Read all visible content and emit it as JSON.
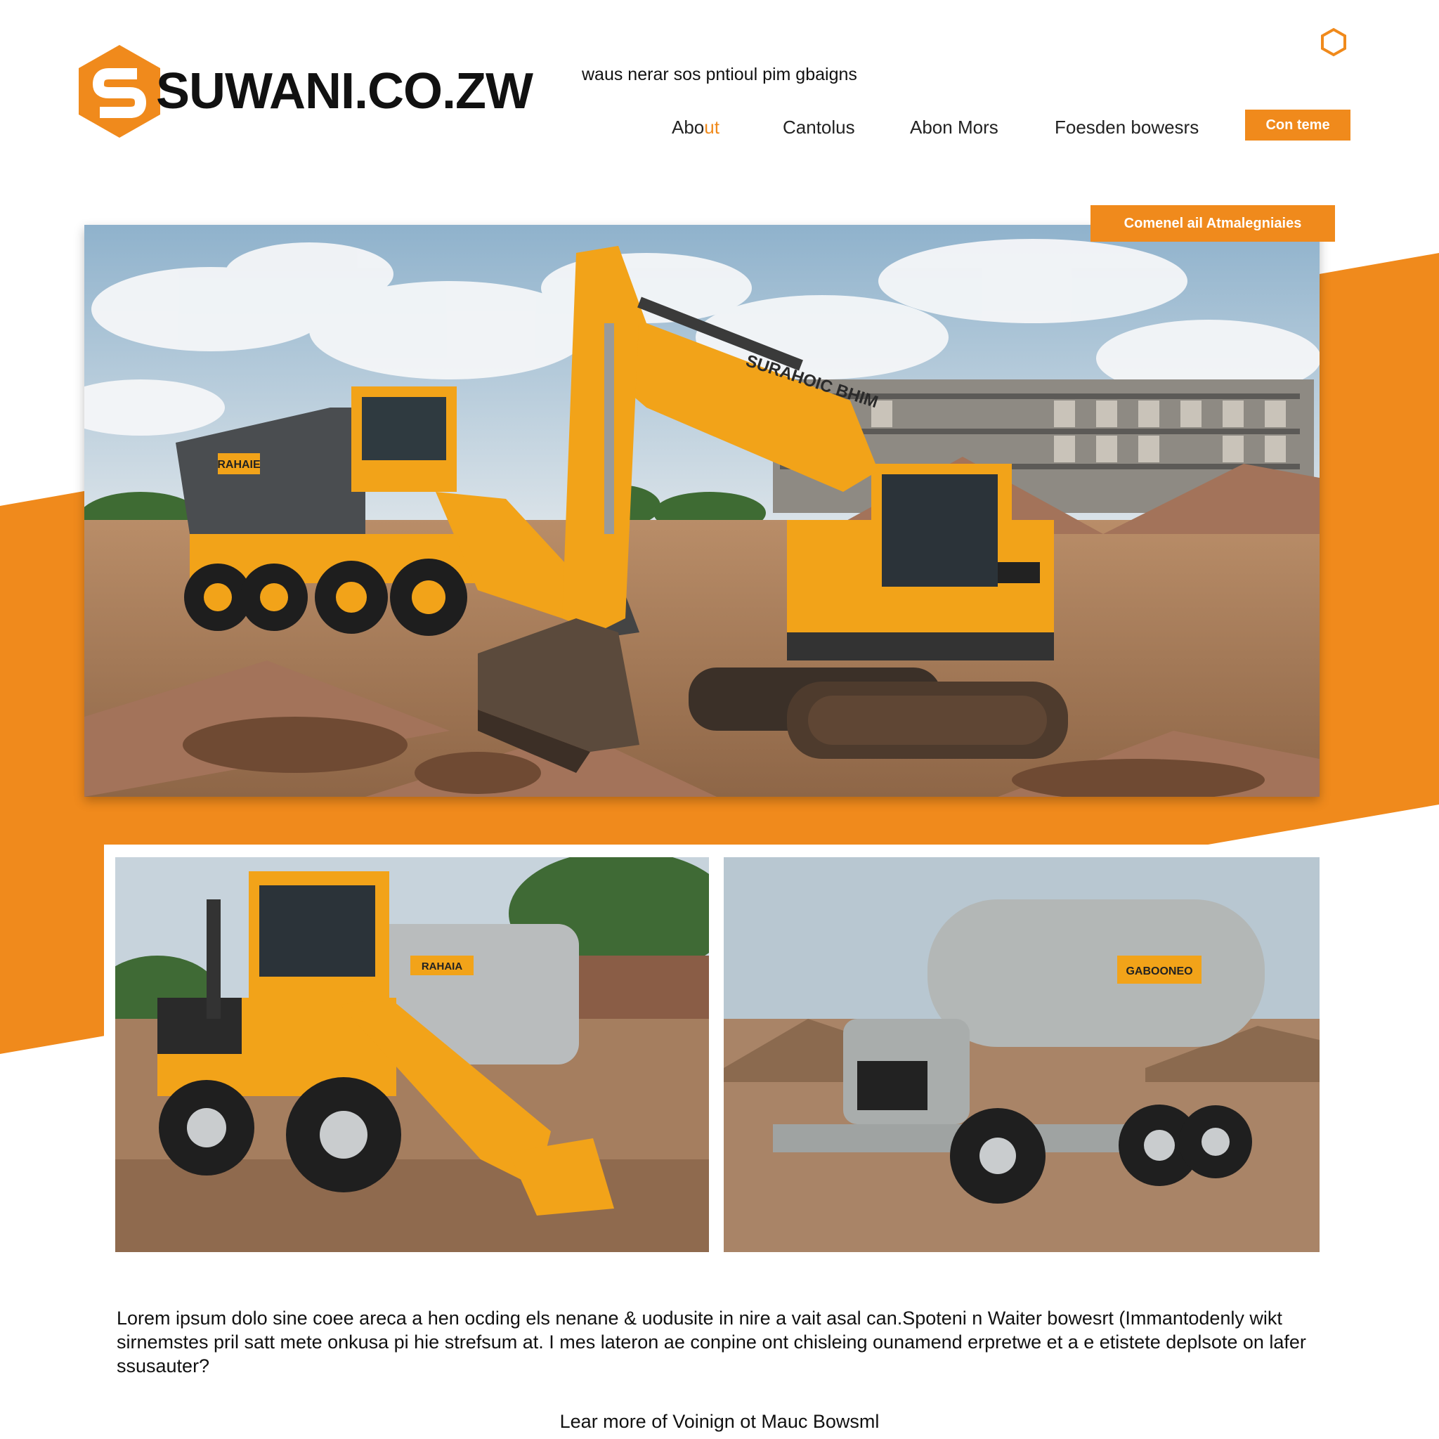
{
  "header": {
    "logo_text": "SUWANI.CO.ZW",
    "tagline": "waus nerar sos pntioul pim gbaigns",
    "nav": {
      "about_main": "Abo",
      "about_accent": "ut",
      "item2": "Cantolus",
      "item3": "Abon Mors",
      "item4": "Foesden bowesrs"
    },
    "cta_label": "Con teme"
  },
  "hero": {
    "tag": "Comenel ail Atmalegniaies",
    "excavator_label": "SURAHOIC BHIM",
    "dumper_label": "RAHAIE"
  },
  "thumbs": {
    "left_label": "RAHAIA",
    "right_label": "GABOONEO"
  },
  "body": {
    "paragraph": "Lorem ipsum dolo sine coee areca a hen ocding els nenane & uodusite in nire a vait asal can.Spoteni n Waiter bowesrt (Immantodenly wikt sirnemstes pril satt mete onkusa pi hie strefsum at. I mes lateron ae conpine ont chisleing ounamend erpretwe et a e etistete deplsote on lafer ssusauter?",
    "learn_more": "Lear more of Voinign ot Mauc Bowsml"
  },
  "colors": {
    "accent": "#f08a1c",
    "machine_yellow": "#f2a319"
  },
  "icons": {
    "logo": "hexagon-s-logo",
    "corner": "hexagon-outline-icon"
  }
}
